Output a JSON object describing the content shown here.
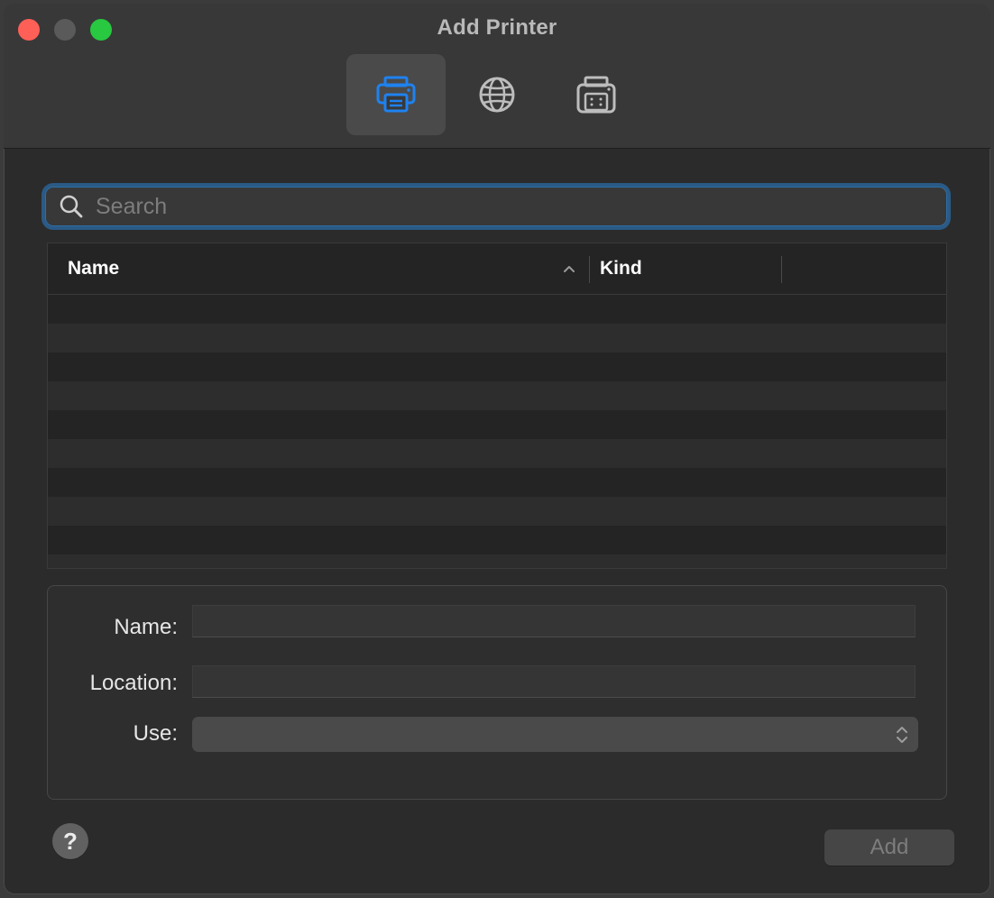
{
  "window": {
    "title": "Add Printer"
  },
  "toolbar": {
    "items": [
      {
        "icon": "printer-icon",
        "active": true
      },
      {
        "icon": "globe-icon",
        "active": false
      },
      {
        "icon": "fax-printer-icon",
        "active": false
      }
    ]
  },
  "search": {
    "placeholder": "Search",
    "value": ""
  },
  "table": {
    "columns": [
      "Name",
      "Kind"
    ],
    "sort_column": "Name",
    "sort_direction": "ascending",
    "rows": []
  },
  "details": {
    "name_label": "Name:",
    "name_value": "",
    "location_label": "Location:",
    "location_value": "",
    "use_label": "Use:",
    "use_value": ""
  },
  "footer": {
    "help_label": "?",
    "add_label": "Add"
  },
  "colors": {
    "accent": "#1e82f0",
    "focus_ring": "#2a5a85",
    "traffic_close": "#fe5f57",
    "traffic_minimize": "#5a5a5a",
    "traffic_maximize": "#28c840"
  }
}
